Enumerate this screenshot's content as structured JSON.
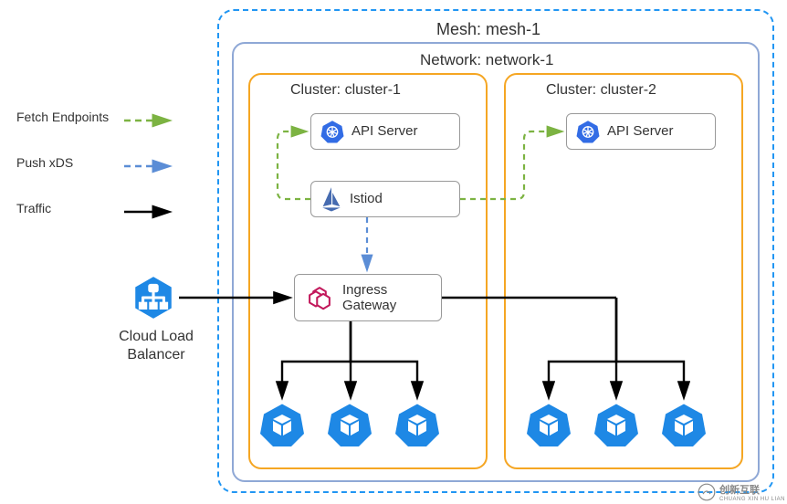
{
  "legend": {
    "fetch": "Fetch Endpoints",
    "push": "Push xDS",
    "traffic": "Traffic"
  },
  "mesh": {
    "title": "Mesh: mesh-1"
  },
  "network": {
    "title": "Network: network-1"
  },
  "clusters": {
    "c1": {
      "title": "Cluster: cluster-1"
    },
    "c2": {
      "title": "Cluster: cluster-2"
    }
  },
  "components": {
    "api_server1": "API Server",
    "api_server2": "API Server",
    "istiod": "Istiod",
    "ingress_line1": "Ingress",
    "ingress_line2": "Gateway"
  },
  "lb": {
    "line1": "Cloud Load",
    "line2": "Balancer"
  },
  "colors": {
    "green": "#7CB342",
    "blue": "#5B8DD6",
    "black": "#000000",
    "orange": "#F5A623",
    "meshBlue": "#2196F3",
    "istioBlue": "#466BB0",
    "k8sBlue": "#326CE5",
    "magenta": "#C2185B",
    "podBlue": "#1E88E5"
  },
  "watermark": {
    "text": "创新互联",
    "sub": "CHUANG XIN HU LIAN"
  }
}
